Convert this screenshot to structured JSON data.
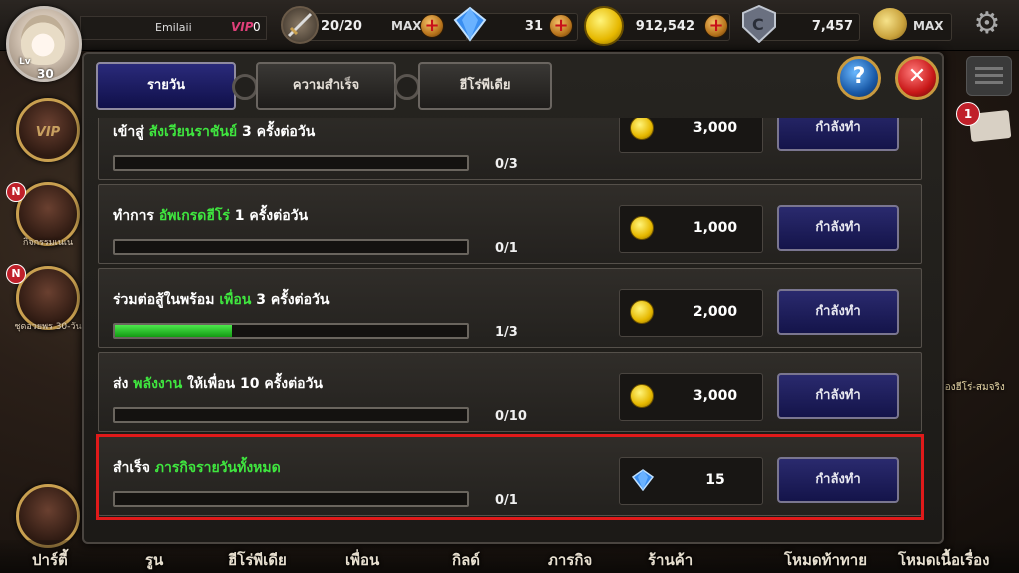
{
  "player": {
    "name": "Emilaii",
    "vip_label": "VIP",
    "vip_level": "0",
    "lv_label": "Lv",
    "level": "30"
  },
  "resources": {
    "stamina": "20/20",
    "stamina_max": "MAX",
    "gems": "31",
    "gold": "912,542",
    "tokens": "7,457",
    "friend_max": "MAX"
  },
  "sidebar": {
    "vip": "VIP",
    "badge_n": "N",
    "item2_label": "กิจกรรมเนเน",
    "item3_label": "ชุดอวยพร 30-วัน"
  },
  "right": {
    "mail_count": "1",
    "side_label": "ห้องฮีโร่-สมจริง"
  },
  "tabs": {
    "daily": "รายวัน",
    "achievement": "ความสำเร็จ",
    "heropedia": "ฮีโร่พีเดีย"
  },
  "buttons": {
    "help": "?",
    "close": "✕"
  },
  "quests": [
    {
      "title_pre": "เข้าสู่ ",
      "title_hl": "สังเวียนราชันย์",
      "title_post": " 3 ครั้งต่อวัน",
      "progress": 0,
      "progress_text": "0/3",
      "reward_type": "gold",
      "reward": "3,000",
      "button": "กำลังทำ"
    },
    {
      "title_pre": "ทำการ ",
      "title_hl": "อัพเกรดฮีโร่",
      "title_post": " 1 ครั้งต่อวัน",
      "progress": 0,
      "progress_text": "0/1",
      "reward_type": "gold",
      "reward": "1,000",
      "button": "กำลังทำ"
    },
    {
      "title_pre": "ร่วมต่อสู้ในพร้อม ",
      "title_hl": "เพื่อน",
      "title_post": " 3 ครั้งต่อวัน",
      "progress": 0.333,
      "progress_text": "1/3",
      "reward_type": "gold",
      "reward": "2,000",
      "button": "กำลังทำ"
    },
    {
      "title_pre": "ส่ง ",
      "title_hl": "พลังงาน",
      "title_post": " ให้เพื่อน 10 ครั้งต่อวัน",
      "progress": 0,
      "progress_text": "0/10",
      "reward_type": "gold",
      "reward": "3,000",
      "button": "กำลังทำ"
    },
    {
      "title_pre": "สำเร็จ ",
      "title_hl": "ภารกิจรายวันทั้งหมด",
      "title_post": "",
      "progress": 0,
      "progress_text": "0/1",
      "reward_type": "gem",
      "reward": "15",
      "button": "กำลังทำ"
    }
  ],
  "bottom_nav": [
    "ปาร์ตี้",
    "รูน",
    "ฮีโร่พีเดีย",
    "เพื่อน",
    "กิลด์",
    "ภารกิจ",
    "ร้านค้า",
    "โหมดท้าทาย",
    "โหมดเนื้อเรื่อง"
  ],
  "colors": {
    "highlight_text": "#3fe63f",
    "button_bg": "#1a1a5a",
    "selection_border": "#e01a1a"
  }
}
